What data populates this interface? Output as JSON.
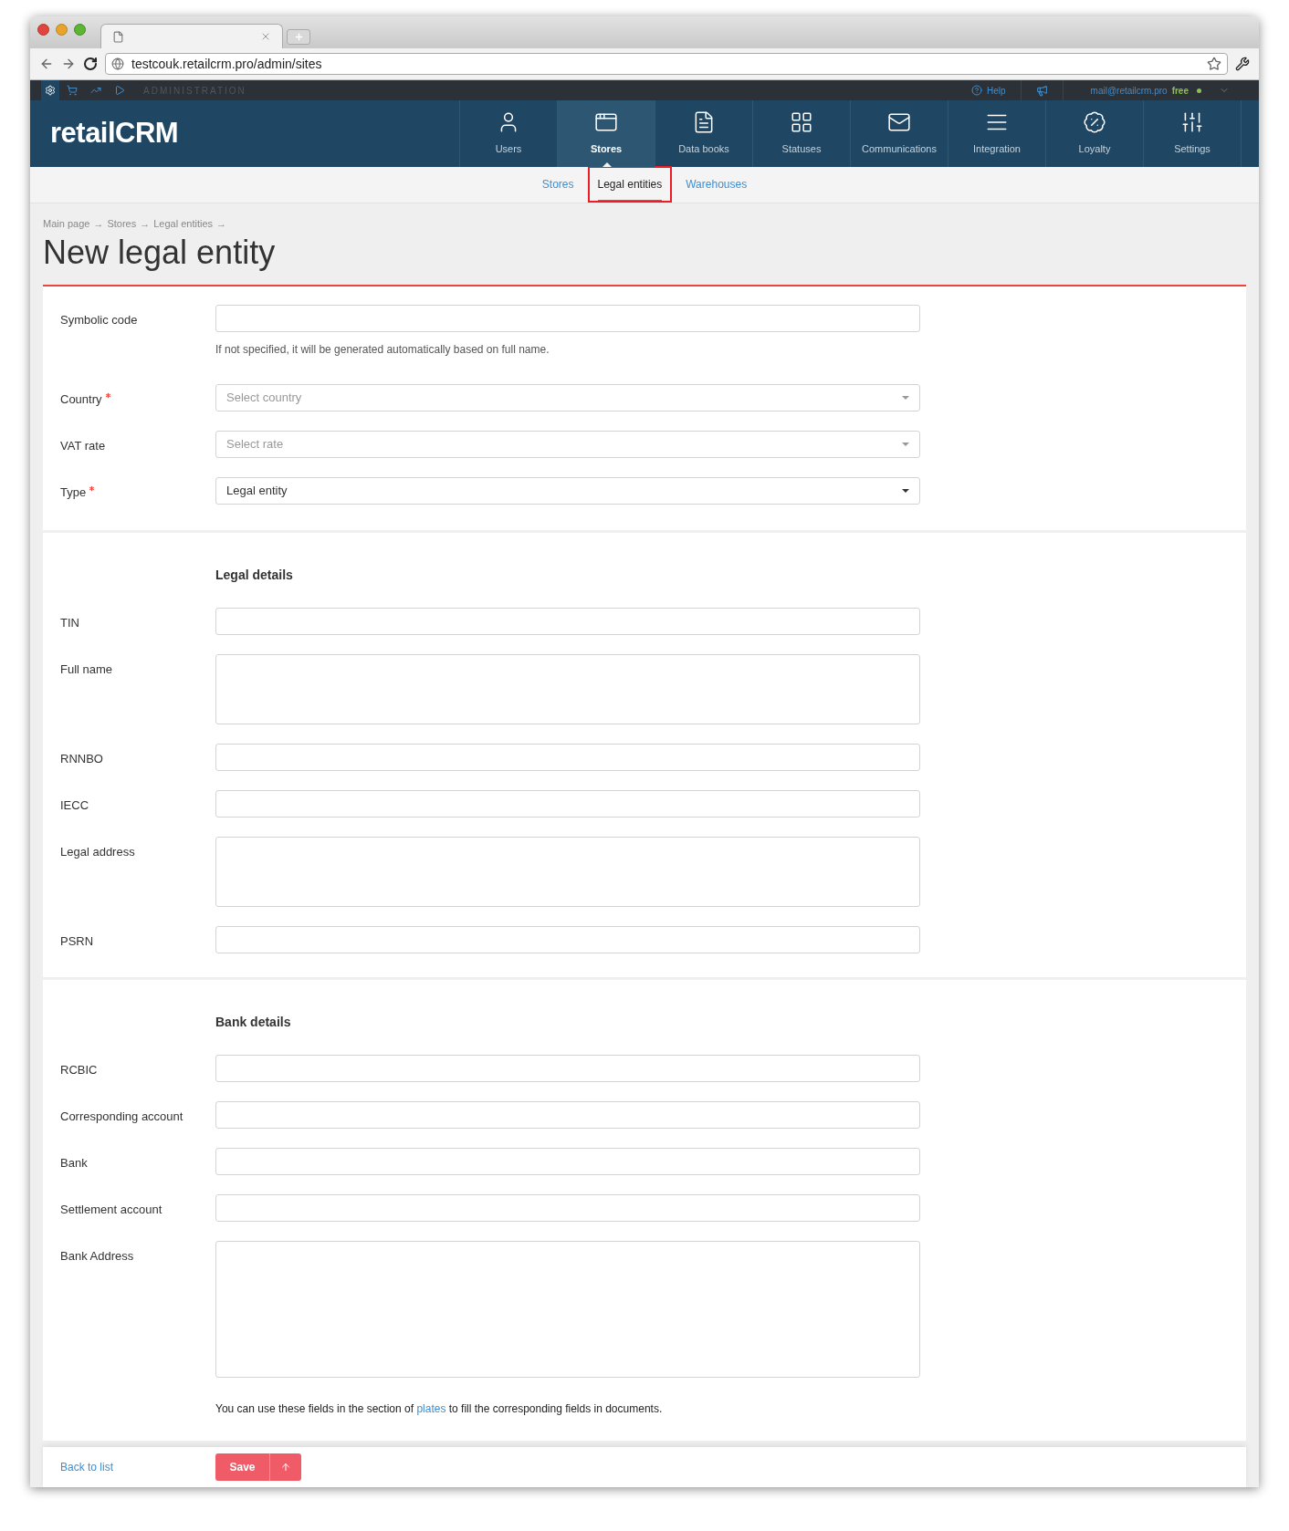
{
  "browser": {
    "url": "testcouk.retailcrm.pro/admin/sites"
  },
  "admin_bar": {
    "section": "ADMINISTRATION",
    "help": "Help",
    "email": "mail@retailcrm.pro",
    "plan": "free"
  },
  "logo": "retailCRM",
  "nav": [
    {
      "label": "Users",
      "selected": false
    },
    {
      "label": "Stores",
      "selected": true
    },
    {
      "label": "Data books",
      "selected": false
    },
    {
      "label": "Statuses",
      "selected": false
    },
    {
      "label": "Communications",
      "selected": false
    },
    {
      "label": "Integration",
      "selected": false
    },
    {
      "label": "Loyalty",
      "selected": false
    },
    {
      "label": "Settings",
      "selected": false
    }
  ],
  "subtabs": [
    {
      "label": "Stores",
      "selected": false
    },
    {
      "label": "Legal entities",
      "selected": true
    },
    {
      "label": "Warehouses",
      "selected": false
    }
  ],
  "breadcrumb": {
    "items": [
      "Main page",
      "Stores",
      "Legal entities"
    ],
    "separator": "→"
  },
  "title": "New legal entity",
  "sections": [
    {
      "fields": [
        {
          "label": "Symbolic code",
          "kind": "input",
          "required": false,
          "hint": "If not specified, it will be generated automatically based on full name."
        },
        {
          "label": "Country",
          "kind": "select",
          "required": true,
          "placeholder": "Select country"
        },
        {
          "label": "VAT rate",
          "kind": "select",
          "required": false,
          "placeholder": "Select rate"
        },
        {
          "label": "Type",
          "kind": "select",
          "required": true,
          "value": "Legal entity"
        }
      ]
    },
    {
      "heading": "Legal details",
      "fields": [
        {
          "label": "TIN",
          "kind": "input",
          "required": false
        },
        {
          "label": "Full name",
          "kind": "textarea",
          "required": false
        },
        {
          "label": "RNNBO",
          "kind": "input",
          "required": false
        },
        {
          "label": "IECC",
          "kind": "input",
          "required": false
        },
        {
          "label": "Legal address",
          "kind": "textarea",
          "required": false
        },
        {
          "label": "PSRN",
          "kind": "input",
          "required": false
        }
      ]
    },
    {
      "heading": "Bank details",
      "fields": [
        {
          "label": "RCBIC",
          "kind": "input",
          "required": false
        },
        {
          "label": "Corresponding account",
          "kind": "input",
          "required": false
        },
        {
          "label": "Bank",
          "kind": "input",
          "required": false
        },
        {
          "label": "Settlement account",
          "kind": "input",
          "required": false
        },
        {
          "label": "Bank Address",
          "kind": "bigtextarea",
          "required": false
        }
      ],
      "note": {
        "before": "You can use these fields in the section of",
        "link": "plates",
        "after": "to fill the corresponding fields in documents."
      }
    }
  ],
  "footer": {
    "back": "Back to list",
    "save": "Save"
  }
}
